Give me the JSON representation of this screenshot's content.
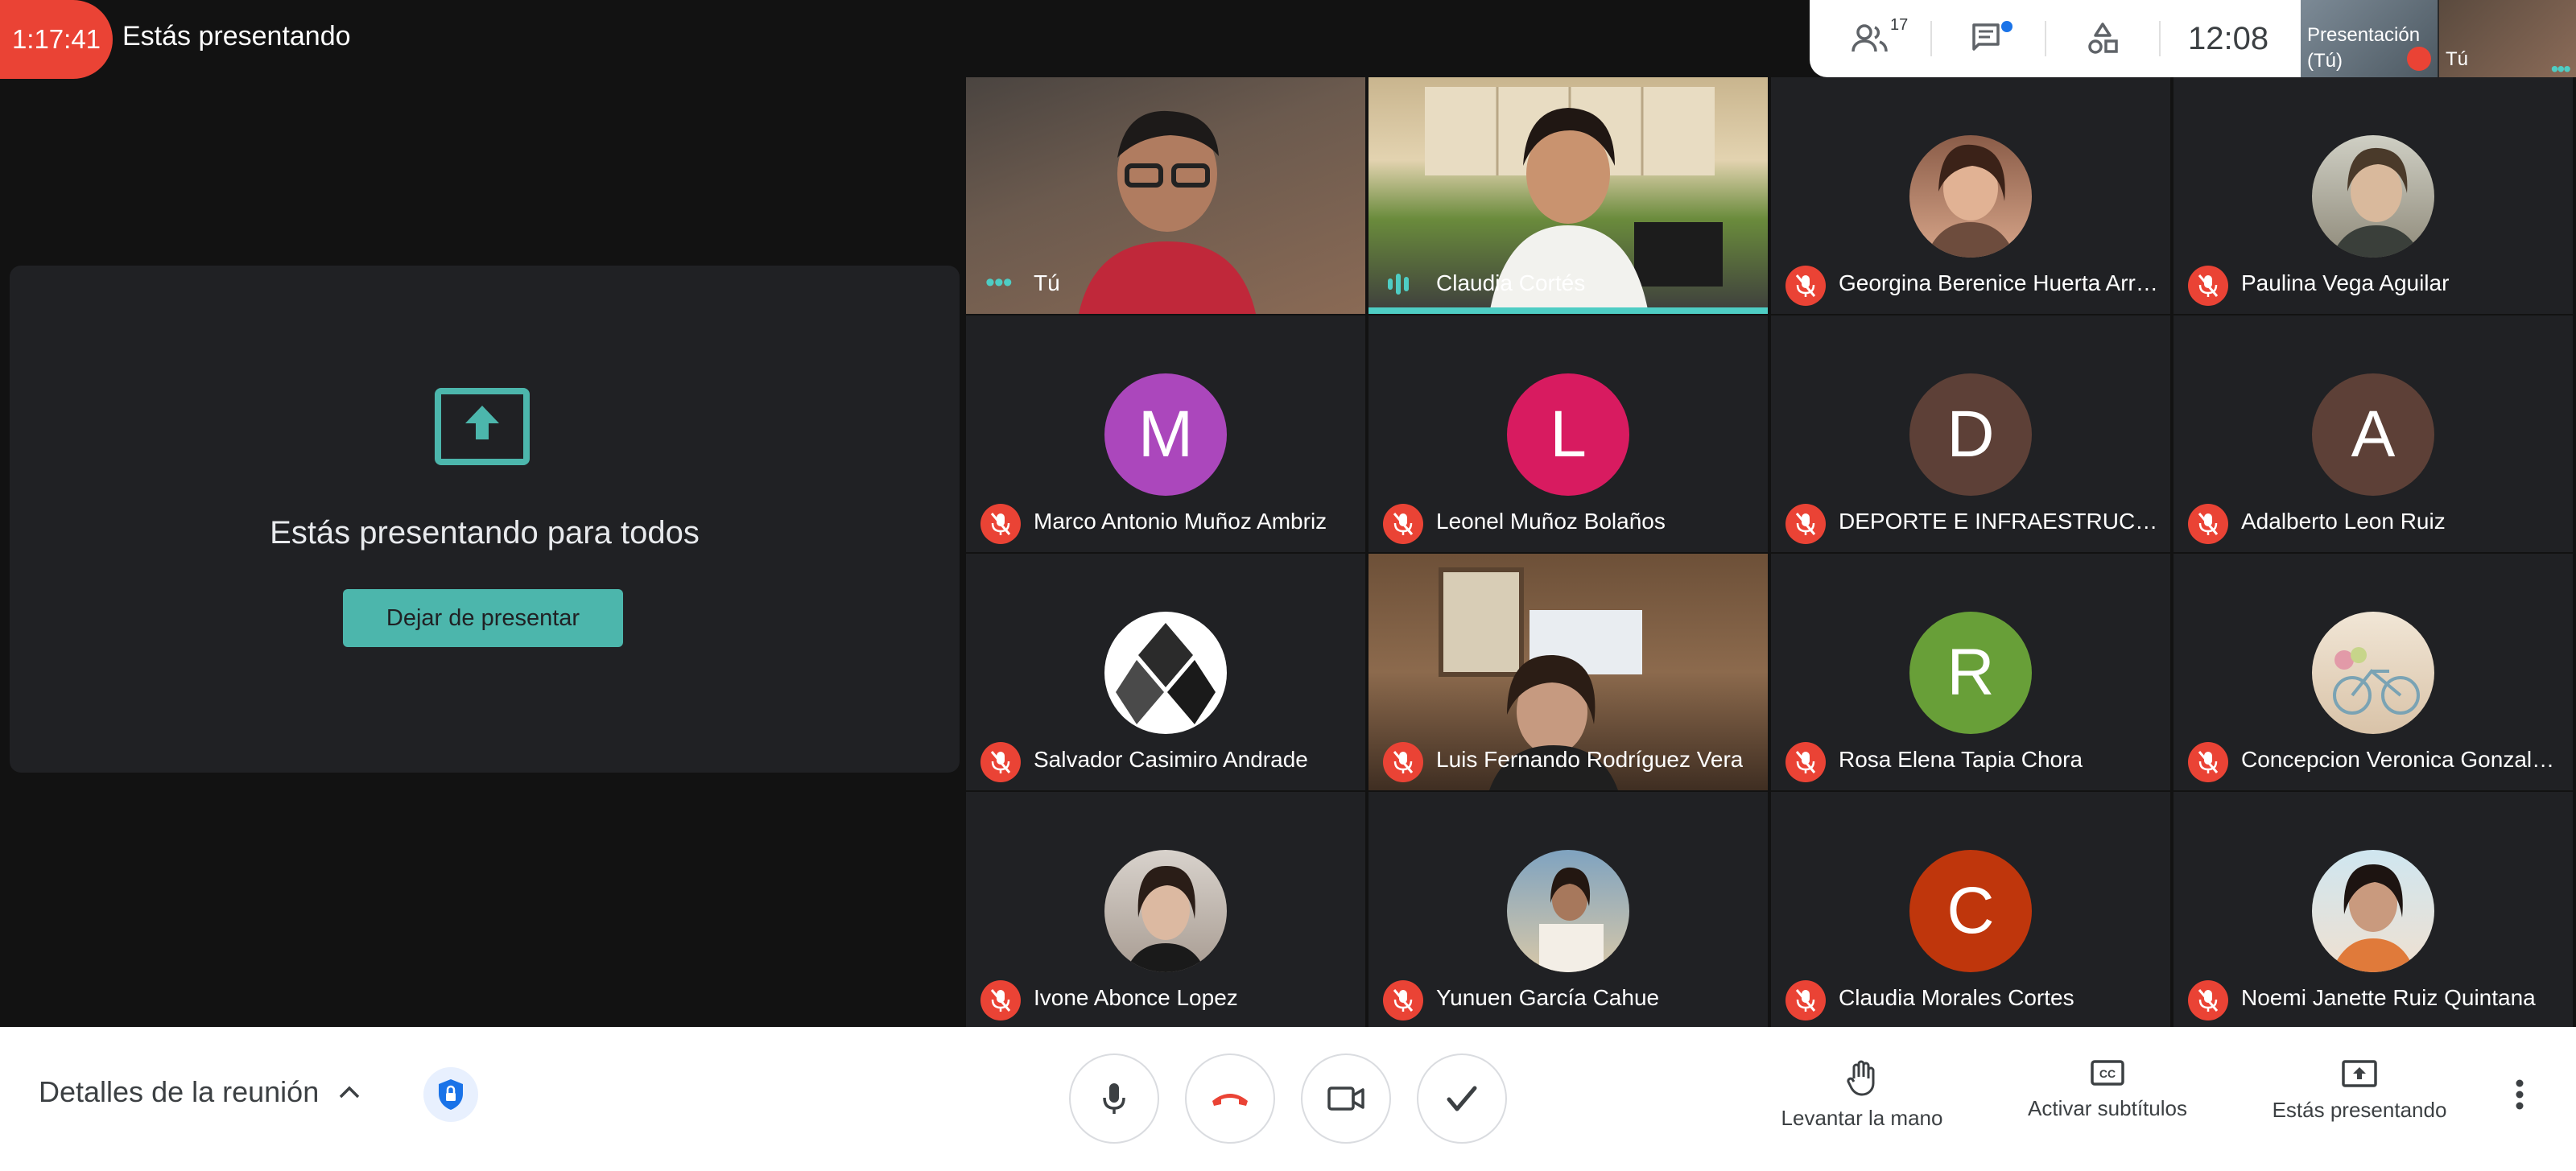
{
  "header": {
    "timer": "1:17:41",
    "title": "Estás presentando",
    "participant_count": "17",
    "clock": "12:08"
  },
  "self_preview": {
    "presentation_label": "Presentación (Tú)",
    "you_label": "Tú"
  },
  "present_card": {
    "message": "Estás presentando para todos",
    "stop_label": "Dejar de presentar"
  },
  "participants": [
    {
      "name": "Tú"
    },
    {
      "name": "Claudia Cortés"
    },
    {
      "name": "Georgina Berenice Huerta Arre..."
    },
    {
      "name": "Paulina Vega Aguilar"
    },
    {
      "name": "Marco Antonio Muñoz Ambriz",
      "initial": "M"
    },
    {
      "name": "Leonel Muñoz Bolaños",
      "initial": "L"
    },
    {
      "name": "DEPORTE E INFRAESTRUCTU...",
      "initial": "D"
    },
    {
      "name": "Adalberto Leon Ruiz",
      "initial": "A"
    },
    {
      "name": "Salvador Casimiro Andrade"
    },
    {
      "name": "Luis Fernando Rodríguez Vera"
    },
    {
      "name": "Rosa Elena Tapia Chora",
      "initial": "R"
    },
    {
      "name": "Concepcion Veronica Gonzale..."
    },
    {
      "name": "Ivone Abonce Lopez"
    },
    {
      "name": "Yunuen García Cahue"
    },
    {
      "name": "Claudia Morales Cortes",
      "initial": "C"
    },
    {
      "name": "Noemi Janette Ruiz Quintana"
    }
  ],
  "colors": {
    "accent": "#4ecdc4",
    "mute_red": "#ea4335",
    "avatar_M": "#ab47bc",
    "avatar_L": "#d81b60",
    "avatar_D": "#5d4037",
    "avatar_A": "#5d4037",
    "avatar_R": "#689f38",
    "avatar_C": "#bf360c"
  },
  "bottom": {
    "details_label": "Detalles de la reunión",
    "raise_hand": "Levantar la mano",
    "captions": "Activar subtítulos",
    "presenting": "Estás presentando"
  }
}
